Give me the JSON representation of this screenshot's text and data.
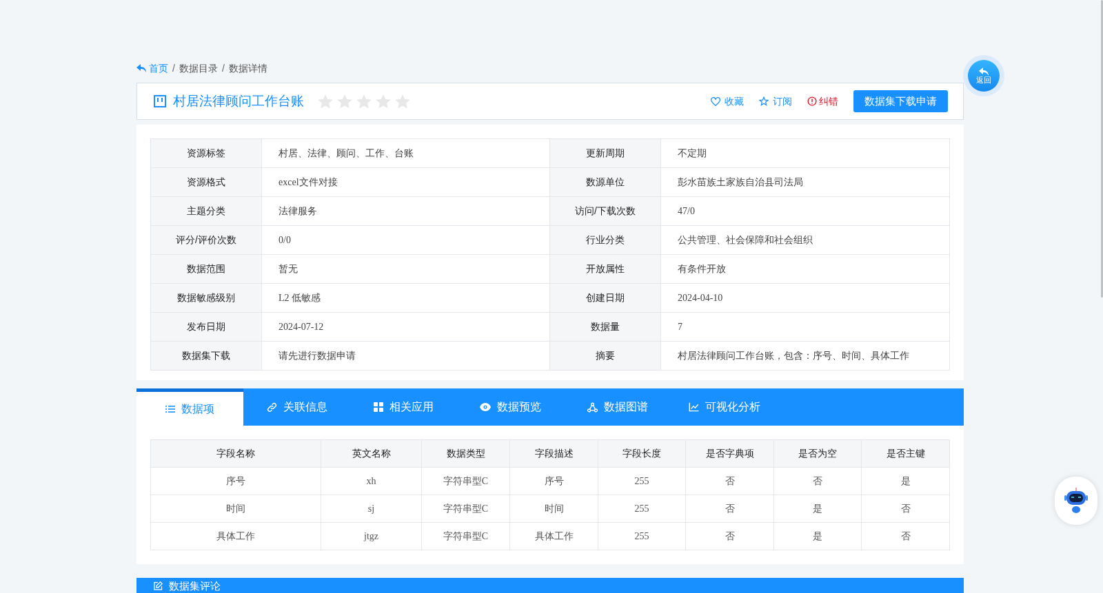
{
  "breadcrumb": [
    {
      "label": "首页",
      "kind": "home"
    },
    {
      "label": "数据目录",
      "kind": "plain"
    },
    {
      "label": "数据详情",
      "kind": "plain"
    }
  ],
  "breadcrumb_separator": "/",
  "dataset": {
    "title": "村居法律顾问工作台账",
    "stars": 0
  },
  "actions": [
    {
      "label": "收藏",
      "kind": "heart"
    },
    {
      "label": "订阅",
      "kind": "star"
    },
    {
      "label": "纠错",
      "kind": "alert"
    }
  ],
  "apply_button": "数据集下载申请",
  "back_button": "返回",
  "info": [
    [
      "资源标签",
      "村居、法律、顾问、工作、台账",
      "更新周期",
      "不定期"
    ],
    [
      "资源格式",
      "excel文件对接",
      "数源单位",
      "彭水苗族土家族自治县司法局"
    ],
    [
      "主题分类",
      "法律服务",
      "访问/下载次数",
      "47/0"
    ],
    [
      "评分/评价次数",
      "0/0",
      "行业分类",
      "公共管理、社会保障和社会组织"
    ],
    [
      "数据范围",
      "暂无",
      "开放属性",
      "有条件开放"
    ],
    [
      "数据敏感级别",
      "L2 低敏感",
      "创建日期",
      "2024-04-10"
    ],
    [
      "发布日期",
      "2024-07-12",
      "数据量",
      "7"
    ],
    [
      "数据集下载",
      "请先进行数据申请",
      "摘要",
      "村居法律顾问工作台账，包含：序号、时间、具体工作"
    ]
  ],
  "tabs": [
    {
      "label": "数据项",
      "kind": "list",
      "selected": true
    },
    {
      "label": "关联信息",
      "kind": "link",
      "selected": false
    },
    {
      "label": "相关应用",
      "kind": "grid",
      "selected": false
    },
    {
      "label": "数据预览",
      "kind": "eye",
      "selected": false
    },
    {
      "label": "数据图谱",
      "kind": "graph",
      "selected": false
    },
    {
      "label": "可视化分析",
      "kind": "chart",
      "selected": false
    }
  ],
  "fields": {
    "columns": [
      "字段名称",
      "英文名称",
      "数据类型",
      "字段描述",
      "字段长度",
      "是否字典项",
      "是否为空",
      "是否主键"
    ],
    "rows": [
      [
        "序号",
        "xh",
        "字符串型C",
        "序号",
        "255",
        "否",
        "否",
        "是"
      ],
      [
        "时间",
        "sj",
        "字符串型C",
        "时间",
        "255",
        "否",
        "是",
        "否"
      ],
      [
        "具体工作",
        "jtgz",
        "字符串型C",
        "具体工作",
        "255",
        "否",
        "是",
        "否"
      ]
    ]
  },
  "comments_title": "数据集评论"
}
